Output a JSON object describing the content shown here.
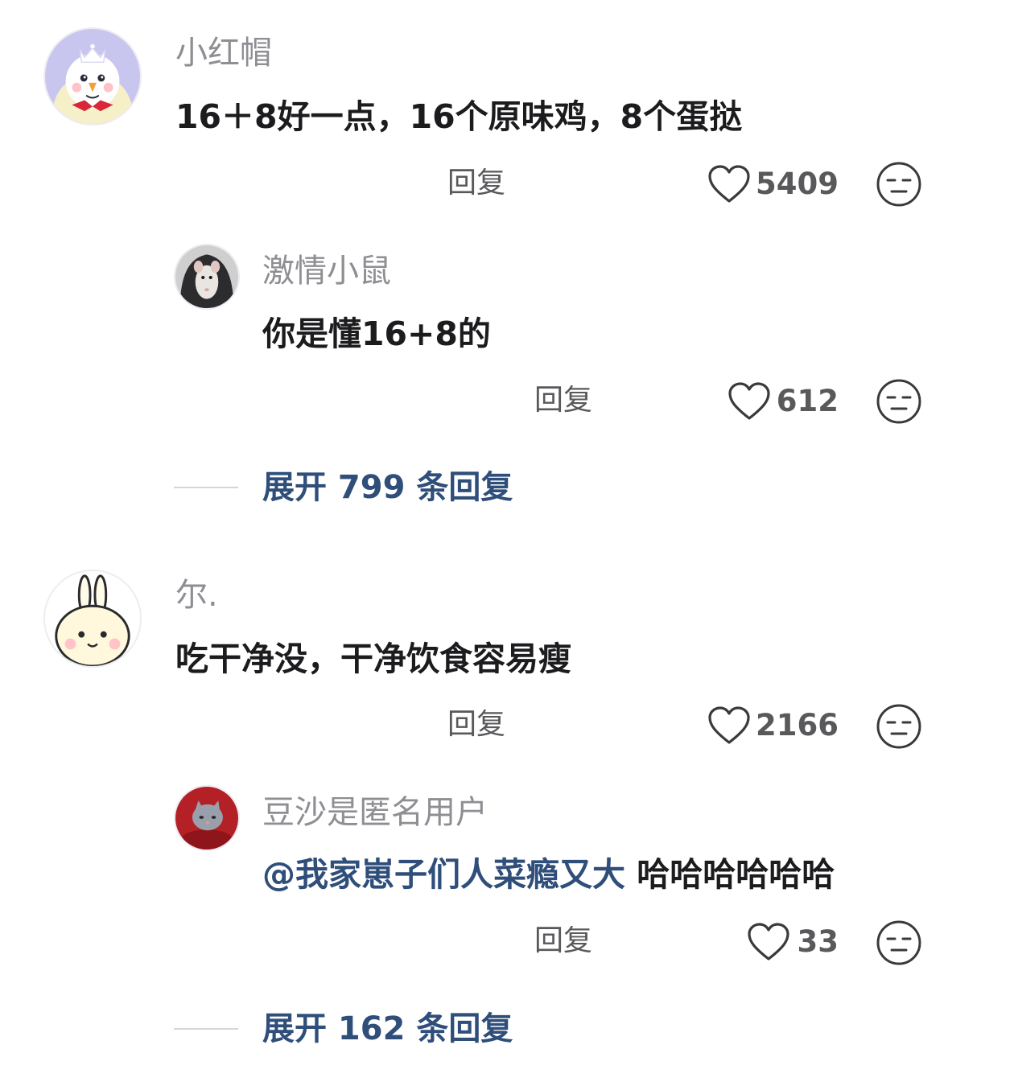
{
  "comments": [
    {
      "username": "小红帽",
      "text": "16＋8好一点，16个原味鸡，8个蛋挞",
      "reply_label": "回复",
      "likes": "5409",
      "replies": [
        {
          "username": "激情小鼠",
          "text": "你是懂16+8的",
          "reply_label": "回复",
          "likes": "612"
        }
      ],
      "expand_label": "展开 799 条回复"
    },
    {
      "username": "尔.",
      "text": "吃干净没，干净饮食容易瘦",
      "reply_label": "回复",
      "likes": "2166",
      "replies": [
        {
          "username": "豆沙是匿名用户",
          "mention": "@我家崽子们人菜瘾又大",
          "text": " 哈哈哈哈哈哈",
          "reply_label": "回复",
          "likes": "33"
        }
      ],
      "expand_label": "展开 162 条回复"
    }
  ],
  "icons": {
    "like": "heart-outline-icon",
    "dislike": "unamused-face-icon"
  },
  "colors": {
    "username": "#8e8e93",
    "content": "#1c1c1e",
    "action": "#59595c",
    "link": "#2f4e7a"
  }
}
